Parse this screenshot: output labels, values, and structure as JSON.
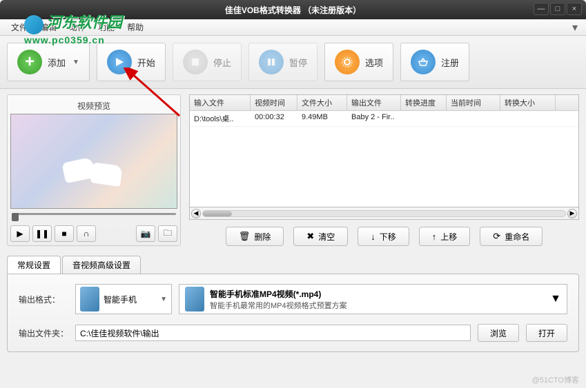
{
  "watermark": {
    "text": "河东软件园",
    "url": "www.pc0359.cn"
  },
  "title": "佳佳VOB格式转换器   （未注册版本）",
  "menu": {
    "file": "文件",
    "edit": "编辑",
    "action": "动作",
    "function": "功能",
    "help": "帮助"
  },
  "toolbar": {
    "add": "添加",
    "start": "开始",
    "stop": "停止",
    "pause": "暂停",
    "options": "选项",
    "register": "注册"
  },
  "preview": {
    "title": "视频预览"
  },
  "table": {
    "headers": [
      "输入文件",
      "视频时间",
      "文件大小",
      "输出文件",
      "转换进度",
      "当前时间",
      "转换大小"
    ],
    "rows": [
      {
        "input": "D:\\tools\\桌..",
        "time": "00:00:32",
        "size": "9.49MB",
        "output": "Baby 2 - Fir..",
        "progress": "",
        "curtime": "",
        "convsize": ""
      }
    ]
  },
  "listbtns": {
    "delete": "删除",
    "clear": "清空",
    "down": "下移",
    "up": "上移",
    "rename": "重命名"
  },
  "tabs": {
    "general": "常规设置",
    "advanced": "音视频高级设置"
  },
  "form": {
    "format_label": "输出格式：",
    "format_device": "智能手机",
    "format_title": "智能手机标准MP4视频(*.mp4)",
    "format_desc": "智能手机最常用的MP4视频格式预置方案",
    "folder_label": "输出文件夹：",
    "folder_value": "C:\\佳佳视频软件\\输出",
    "browse": "浏览",
    "open": "打开"
  },
  "footer": "@51CTO博客"
}
